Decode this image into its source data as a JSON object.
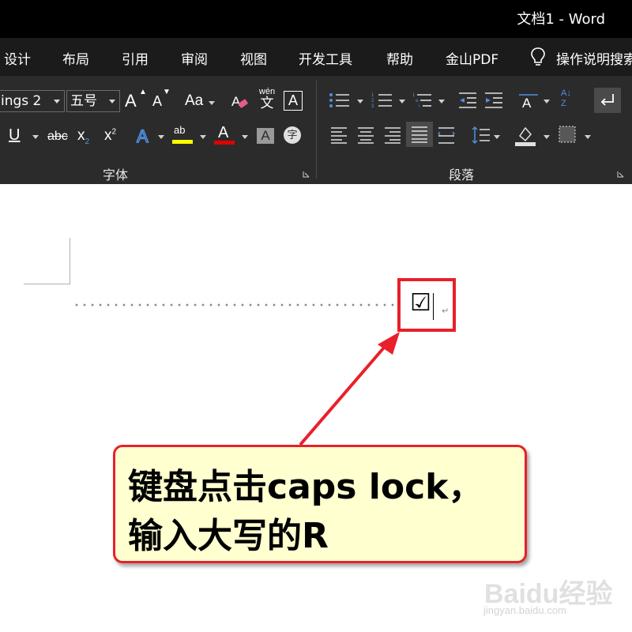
{
  "window": {
    "title": "文档1  -  Word"
  },
  "menu": {
    "tabs": [
      "设计",
      "布局",
      "引用",
      "审阅",
      "视图",
      "开发工具",
      "帮助",
      "金山PDF"
    ],
    "tell_me": "操作说明搜索"
  },
  "ribbon": {
    "font_name": "ings 2",
    "font_size": "五号",
    "grow_font": "A",
    "shrink_font": "A",
    "change_case": "Aa",
    "phonetic_top": "wén",
    "phonetic_bottom": "文",
    "char_border": "A",
    "underline": "U",
    "strikethrough": "abc",
    "subscript": "x",
    "subscript_mark": "2",
    "superscript": "x",
    "superscript_mark": "2",
    "text_effects": "A",
    "highlight": "ab",
    "font_color": "A",
    "char_shading": "A",
    "enclose_char": "字",
    "sort": "A↓",
    "sort_z": "Z",
    "font_group_label": "字体",
    "paragraph_group_label": "段落"
  },
  "document": {
    "symbol": "☑",
    "para_mark": "↵"
  },
  "callout": {
    "line1": "键盘点击caps lock，",
    "line2": "输入大写的R"
  },
  "watermark": {
    "logo": "Baidu经验",
    "url": "jingyan.baidu.com"
  },
  "colors": {
    "highlight_yellow": "#ffff00",
    "font_red": "#e00000",
    "annotation_red": "#e8202a",
    "callout_bg": "#ffffd0"
  }
}
